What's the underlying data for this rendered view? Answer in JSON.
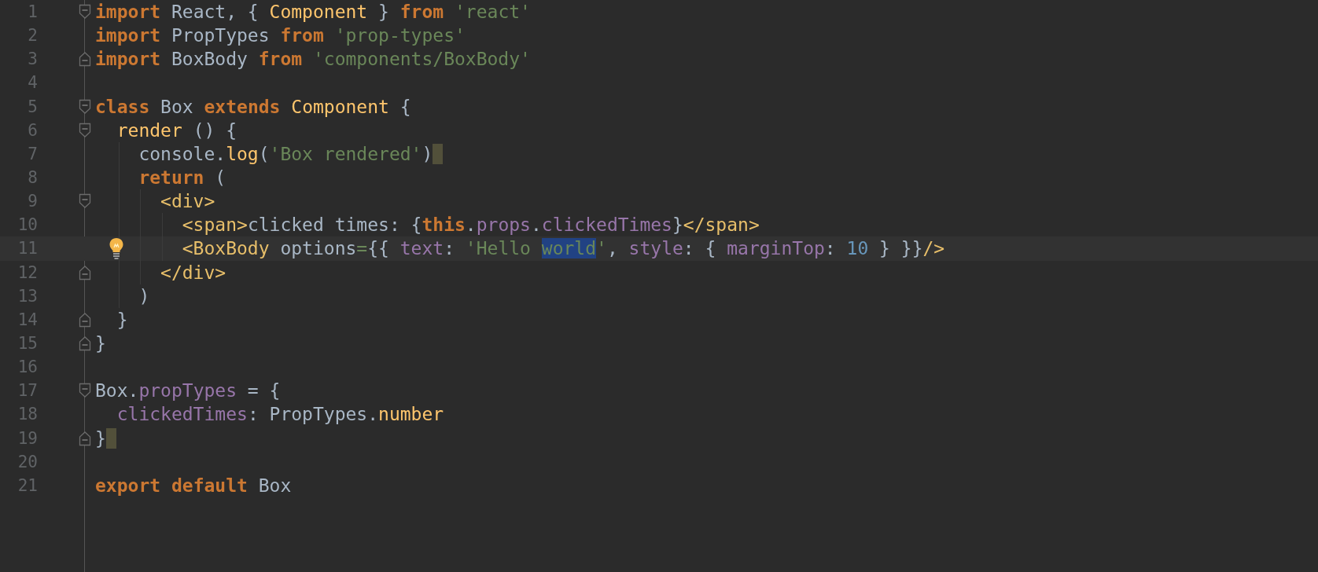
{
  "editor": {
    "lines": [
      {
        "number": "1",
        "fold_start": true,
        "tokens": [
          {
            "text": "import",
            "kind": "keyword"
          },
          {
            "text": " React, { ",
            "kind": "plain"
          },
          {
            "text": "Component",
            "kind": "function"
          },
          {
            "text": " } ",
            "kind": "plain"
          },
          {
            "text": "from ",
            "kind": "keyword"
          },
          {
            "text": "'react'",
            "kind": "string"
          }
        ]
      },
      {
        "number": "2",
        "tokens": [
          {
            "text": "import",
            "kind": "keyword"
          },
          {
            "text": " PropTypes ",
            "kind": "plain"
          },
          {
            "text": "from ",
            "kind": "keyword"
          },
          {
            "text": "'prop-types'",
            "kind": "string"
          }
        ]
      },
      {
        "number": "3",
        "fold_end": true,
        "tokens": [
          {
            "text": "import",
            "kind": "keyword"
          },
          {
            "text": " BoxBody ",
            "kind": "plain"
          },
          {
            "text": "from ",
            "kind": "keyword"
          },
          {
            "text": "'components/BoxBody'",
            "kind": "string"
          }
        ]
      },
      {
        "number": "4"
      },
      {
        "number": "5",
        "fold_start": true,
        "tokens": [
          {
            "text": "class",
            "kind": "keyword"
          },
          {
            "text": " Box ",
            "kind": "plain"
          },
          {
            "text": "extends ",
            "kind": "keyword"
          },
          {
            "text": "Component",
            "kind": "function"
          },
          {
            "text": " {",
            "kind": "plain"
          }
        ]
      },
      {
        "number": "6",
        "fold_start": true,
        "tokens": [
          {
            "text": "  render",
            "kind": "function"
          },
          {
            "text": " () {",
            "kind": "plain"
          }
        ]
      },
      {
        "number": "7",
        "brace_match": true,
        "tokens": [
          {
            "text": "    console.",
            "kind": "plain"
          },
          {
            "text": "log",
            "kind": "function"
          },
          {
            "text": "(",
            "kind": "plain"
          },
          {
            "text": "'Box rendered'",
            "kind": "string"
          },
          {
            "text": ")",
            "kind": "plain"
          }
        ]
      },
      {
        "number": "8",
        "tokens": [
          {
            "text": "    return",
            "kind": "keyword"
          },
          {
            "text": " (",
            "kind": "plain"
          }
        ]
      },
      {
        "number": "9",
        "fold_start": true,
        "tokens": [
          {
            "text": "      <div>",
            "kind": "tag"
          }
        ]
      },
      {
        "number": "10",
        "tokens": [
          {
            "text": "        <span>",
            "kind": "tag"
          },
          {
            "text": "clicked times: {",
            "kind": "plain"
          },
          {
            "text": "this",
            "kind": "keyword"
          },
          {
            "text": ".",
            "kind": "plain"
          },
          {
            "text": "props",
            "kind": "property"
          },
          {
            "text": ".",
            "kind": "plain"
          },
          {
            "text": "clickedTimes",
            "kind": "property"
          },
          {
            "text": "}",
            "kind": "plain"
          },
          {
            "text": "</span>",
            "kind": "tag"
          }
        ]
      },
      {
        "number": "11",
        "current": true,
        "bulb": true,
        "tokens": [
          {
            "text": "        <BoxBody",
            "kind": "tag"
          },
          {
            "text": " options",
            "kind": "plain"
          },
          {
            "text": "=",
            "kind": "string"
          },
          {
            "text": "{{ ",
            "kind": "plain"
          },
          {
            "text": "text",
            "kind": "property"
          },
          {
            "text": ": ",
            "kind": "plain"
          },
          {
            "text": "'Hello ",
            "kind": "string"
          },
          {
            "text": "world",
            "kind": "string",
            "selected": true
          },
          {
            "text": "'",
            "kind": "string"
          },
          {
            "text": ", ",
            "kind": "plain"
          },
          {
            "text": "style",
            "kind": "property"
          },
          {
            "text": ": { ",
            "kind": "plain"
          },
          {
            "text": "marginTop",
            "kind": "property"
          },
          {
            "text": ": ",
            "kind": "plain"
          },
          {
            "text": "10",
            "kind": "number"
          },
          {
            "text": " } }}",
            "kind": "plain"
          },
          {
            "text": "/>",
            "kind": "tag"
          }
        ]
      },
      {
        "number": "12",
        "fold_end": true,
        "tokens": [
          {
            "text": "      </div>",
            "kind": "tag"
          }
        ]
      },
      {
        "number": "13",
        "tokens": [
          {
            "text": "    )",
            "kind": "plain"
          }
        ]
      },
      {
        "number": "14",
        "fold_end": true,
        "tokens": [
          {
            "text": "  }",
            "kind": "plain"
          }
        ]
      },
      {
        "number": "15",
        "fold_end": true,
        "tokens": [
          {
            "text": "}",
            "kind": "plain"
          }
        ]
      },
      {
        "number": "16"
      },
      {
        "number": "17",
        "fold_start": true,
        "tokens": [
          {
            "text": "Box.",
            "kind": "plain"
          },
          {
            "text": "propTypes",
            "kind": "property"
          },
          {
            "text": " = {",
            "kind": "plain"
          }
        ]
      },
      {
        "number": "18",
        "tokens": [
          {
            "text": "  clickedTimes",
            "kind": "property"
          },
          {
            "text": ": PropTypes.",
            "kind": "plain"
          },
          {
            "text": "number",
            "kind": "function"
          }
        ]
      },
      {
        "number": "19",
        "fold_end": true,
        "brace_match": true,
        "tokens": [
          {
            "text": "}",
            "kind": "plain"
          }
        ]
      },
      {
        "number": "20"
      },
      {
        "number": "21",
        "tokens": [
          {
            "text": "export ",
            "kind": "keyword"
          },
          {
            "text": "default",
            "kind": "keyword"
          },
          {
            "text": " Box",
            "kind": "plain"
          }
        ]
      }
    ]
  }
}
